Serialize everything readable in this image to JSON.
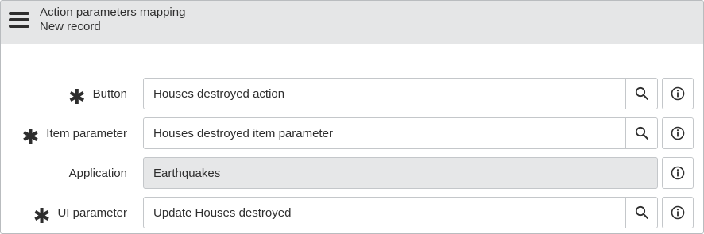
{
  "header": {
    "title": "Action parameters mapping",
    "subtitle": "New record",
    "menu_icon": "hamburger-menu-icon"
  },
  "form": {
    "required_marker": "✱",
    "fields": [
      {
        "label": "Button",
        "required": true,
        "value": "Houses destroyed action",
        "readonly": false,
        "lookup_icon": "search-icon",
        "info_icon": "info-icon"
      },
      {
        "label": "Item parameter",
        "required": true,
        "value": "Houses destroyed item parameter",
        "readonly": false,
        "lookup_icon": "search-icon",
        "info_icon": "info-icon"
      },
      {
        "label": "Application",
        "required": false,
        "value": "Earthquakes",
        "readonly": true,
        "info_icon": "info-icon"
      },
      {
        "label": "UI parameter",
        "required": true,
        "value": "Update Houses destroyed",
        "readonly": false,
        "lookup_icon": "search-icon",
        "info_icon": "info-icon"
      }
    ]
  },
  "colors": {
    "header_bg": "#e5e6e7",
    "readonly_bg": "#e6e7e8",
    "border": "#c4c7ca",
    "text": "#2e2e2e"
  }
}
